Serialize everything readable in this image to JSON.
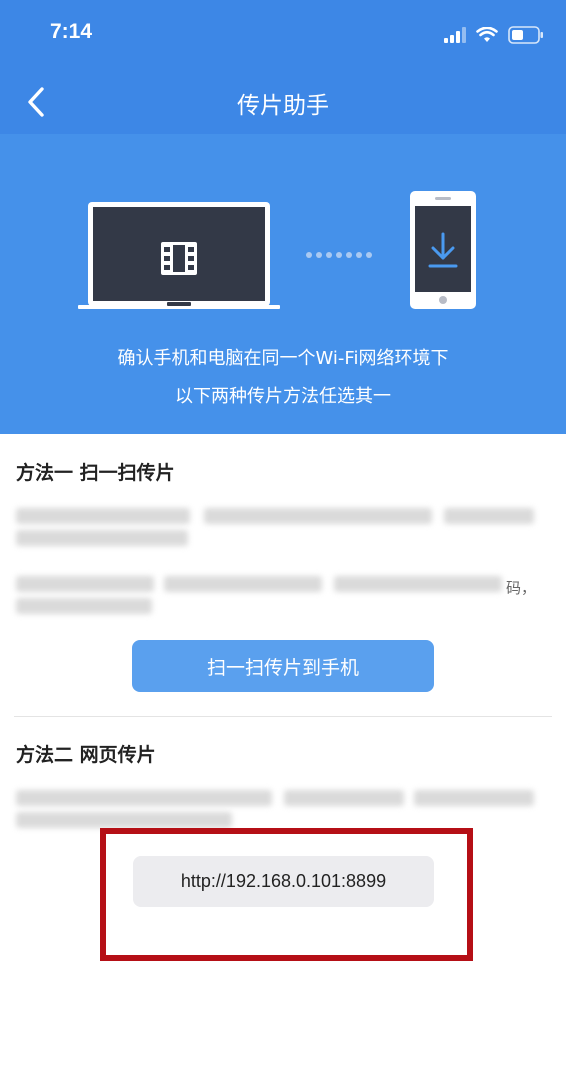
{
  "status_bar": {
    "time": "7:14"
  },
  "nav": {
    "title": "传片助手"
  },
  "hero": {
    "line1": "确认手机和电脑在同一个Wi-Fi网络环境下",
    "line2": "以下两种传片方法任选其一"
  },
  "method1": {
    "title": "方法一 扫一扫传片",
    "visible_tail": "码，",
    "button_label": "扫一扫传片到手机"
  },
  "method2": {
    "title": "方法二 网页传片",
    "url": "http://192.168.0.101:8899"
  },
  "colors": {
    "header_blue": "#3d87e6",
    "hero_blue": "#4591ea",
    "button_blue": "#5aa0ee",
    "highlight_red": "#b50f16"
  },
  "icons": [
    "back-icon",
    "signal-icon",
    "wifi-icon",
    "battery-icon",
    "laptop-icon",
    "film-icon",
    "phone-icon",
    "download-icon"
  ]
}
